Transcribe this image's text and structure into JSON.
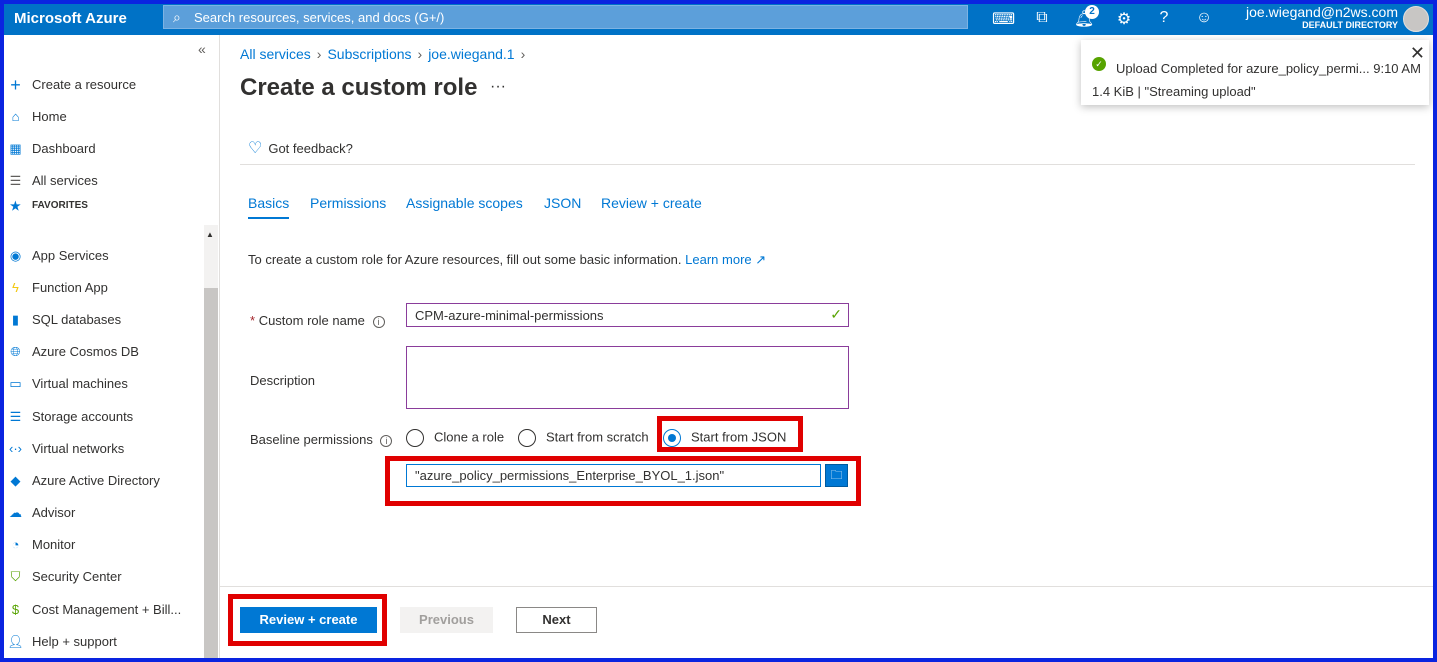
{
  "topbar": {
    "brand": "Microsoft Azure",
    "search_placeholder": "Search resources, services, and docs (G+/)",
    "notifications_count": "2",
    "user_email": "joe.wiegand@n2ws.com",
    "user_directory": "DEFAULT DIRECTORY"
  },
  "sidebar": {
    "collapse": "«",
    "items_top": [
      {
        "label": "Create a resource",
        "icon": "plus-icon"
      },
      {
        "label": "Home",
        "icon": "home-icon"
      },
      {
        "label": "Dashboard",
        "icon": "dashboard-icon"
      },
      {
        "label": "All services",
        "icon": "list-icon"
      }
    ],
    "favorites_label": "FAVORITES",
    "favorites": [
      {
        "label": "App Services",
        "icon": "app-services-icon"
      },
      {
        "label": "Function App",
        "icon": "function-app-icon"
      },
      {
        "label": "SQL databases",
        "icon": "sql-icon"
      },
      {
        "label": "Azure Cosmos DB",
        "icon": "cosmos-icon"
      },
      {
        "label": "Virtual machines",
        "icon": "vm-icon"
      },
      {
        "label": "Storage accounts",
        "icon": "storage-icon"
      },
      {
        "label": "Virtual networks",
        "icon": "vnet-icon"
      },
      {
        "label": "Azure Active Directory",
        "icon": "aad-icon"
      },
      {
        "label": "Advisor",
        "icon": "advisor-icon"
      },
      {
        "label": "Monitor",
        "icon": "monitor-icon"
      },
      {
        "label": "Security Center",
        "icon": "shield-icon"
      },
      {
        "label": "Cost Management + Bill...",
        "icon": "cost-icon"
      },
      {
        "label": "Help + support",
        "icon": "help-support-icon"
      }
    ]
  },
  "breadcrumb": [
    "All services",
    "Subscriptions",
    "joe.wiegand.1"
  ],
  "page": {
    "title": "Create a custom role",
    "more": "···",
    "feedback": "Got feedback?"
  },
  "tabs": [
    "Basics",
    "Permissions",
    "Assignable scopes",
    "JSON",
    "Review + create"
  ],
  "form": {
    "intro_text": "To create a custom role for Azure resources, fill out some basic information.",
    "learn_more": "Learn more",
    "role_name_label": "Custom role name",
    "role_name_value": "CPM-azure-minimal-permissions",
    "description_label": "Description",
    "baseline_label": "Baseline permissions",
    "radio_options": [
      "Clone a role",
      "Start from scratch",
      "Start from JSON"
    ],
    "selected_option": "Start from JSON",
    "file_value": "\"azure_policy_permissions_Enterprise_BYOL_1.json\""
  },
  "footer": {
    "review_create": "Review + create",
    "previous": "Previous",
    "next": "Next"
  },
  "toast": {
    "title": "Upload Completed for azure_policy_permi... 9:10 AM",
    "detail": "1.4 KiB | \"Streaming upload\""
  },
  "colors": {
    "accent": "#0078d4",
    "topbar": "#0072c6",
    "highlight": "#e00000",
    "success": "#57a300"
  }
}
